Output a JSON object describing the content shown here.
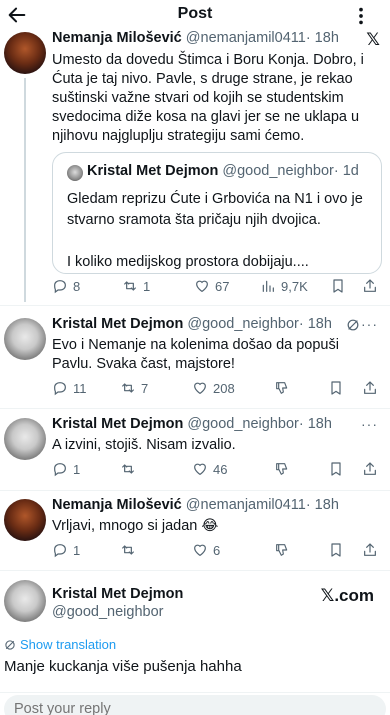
{
  "header": {
    "title": "Post",
    "back_icon": "arrow-left-icon",
    "more_icon": "more-vertical-icon"
  },
  "main_post": {
    "name": "Nemanja Milošević",
    "handle": "@nemanjamil0411",
    "time": "· 18h",
    "text_lines": [
      "Umesto da dovedu Štimca i Boru Konja. Dobro, i",
      "Ćuta je taj nivo. Pavle, s druge strane, je rekao",
      "suštinski važne stvari od kojih se studentskim",
      "svedocima diže kosa na glavi jer se ne uklapa u",
      "njihovu najgluplju strategiju sami ćemo."
    ],
    "quote": {
      "name": "Kristal Met Dejmon",
      "handle": "@good_neighbor",
      "time": "· 1d",
      "text_lines": [
        "Gledam reprizu Ćute i Grbovića na N1 i ovo je",
        "stvarno sramota šta pričaju njih dvojica.",
        "",
        "I koliko medijskog prostora dobijaju...."
      ]
    },
    "replies": "8",
    "reposts": "1",
    "likes": "67",
    "views": "9,7K"
  },
  "replies": [
    {
      "name": "Kristal Met Dejmon",
      "handle": "@good_neighbor",
      "time": "· 18h",
      "text_lines": [
        "Evo i Nemanje na kolenima došao da popuši",
        "Pavlu. Svaka čast, majstore!"
      ],
      "replies": "11",
      "reposts": "7",
      "likes": "208"
    },
    {
      "name": "Kristal Met Dejmon",
      "handle": "@good_neighbor",
      "time": "· 18h",
      "text_lines": [
        "A izvini, stojiš. Nisam izvalio."
      ],
      "replies": "1",
      "reposts": "",
      "likes": "46"
    },
    {
      "name": "Nemanja Milošević",
      "handle": "@nemanjamil0411",
      "time": "· 18h",
      "text_lines": [
        "Vrljavi, mnogo si jadan 😂"
      ],
      "replies": "1",
      "reposts": "",
      "likes": "6"
    }
  ],
  "final_post": {
    "name": "Kristal Met Dejmon",
    "handle": "@good_neighbor",
    "watermark": "𝕏.com",
    "show_translation": "Show translation",
    "text": "Manje kuckanja više pušenja hahha"
  },
  "reply_box": {
    "placeholder": "Post your reply"
  },
  "colors": {
    "accent": "#1d9bf0",
    "muted": "#536471",
    "text": "#0f1419",
    "border": "#cfd9de"
  }
}
